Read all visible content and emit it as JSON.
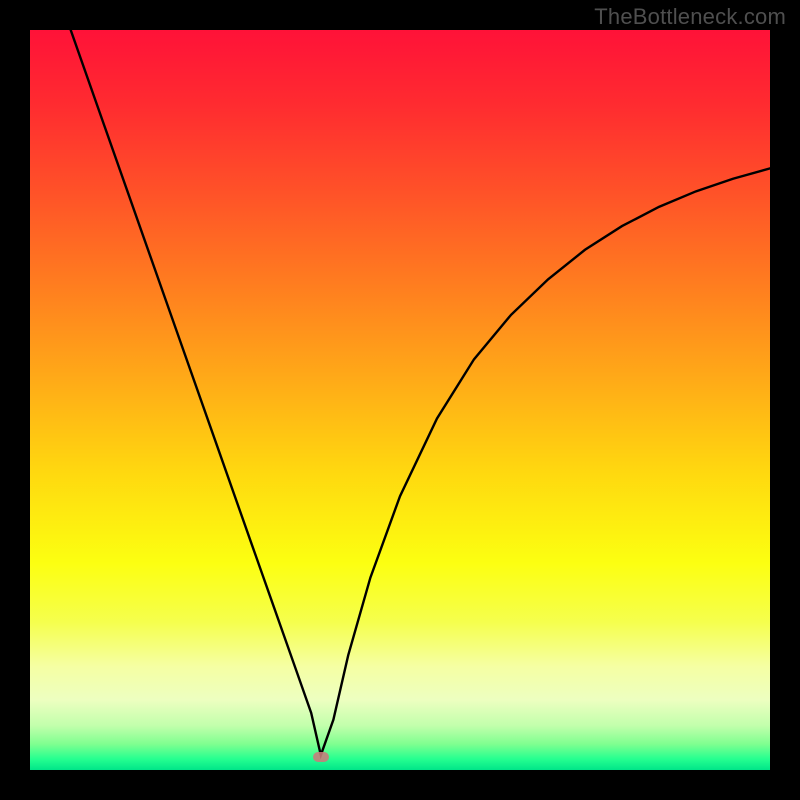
{
  "attribution": "TheBottleneck.com",
  "gradient": {
    "stops": [
      {
        "pos": 0.0,
        "color": "#ff1238"
      },
      {
        "pos": 0.1,
        "color": "#ff2b30"
      },
      {
        "pos": 0.22,
        "color": "#ff5228"
      },
      {
        "pos": 0.35,
        "color": "#ff7f1f"
      },
      {
        "pos": 0.48,
        "color": "#ffad17"
      },
      {
        "pos": 0.6,
        "color": "#ffd90f"
      },
      {
        "pos": 0.72,
        "color": "#fcff11"
      },
      {
        "pos": 0.8,
        "color": "#f5ff4d"
      },
      {
        "pos": 0.86,
        "color": "#f5ffa3"
      },
      {
        "pos": 0.905,
        "color": "#edffc0"
      },
      {
        "pos": 0.94,
        "color": "#c2ffac"
      },
      {
        "pos": 0.965,
        "color": "#7fff90"
      },
      {
        "pos": 0.985,
        "color": "#26ff90"
      },
      {
        "pos": 1.0,
        "color": "#00e589"
      }
    ]
  },
  "marker": {
    "x_frac": 0.393,
    "y_frac": 0.982,
    "color": "#c97b7b"
  },
  "chart_data": {
    "type": "line",
    "title": "",
    "xlabel": "",
    "ylabel": "",
    "xlim": [
      0,
      100
    ],
    "ylim": [
      0,
      100
    ],
    "note": "Values are estimated from pixel positions; axes are unlabeled in the source image. Y represents vertical position (0 = bottom, 100 = top). The curve is an asymmetric V / check-mark shape with minimum near x≈39.",
    "series": [
      {
        "name": "bottleneck-curve",
        "x": [
          5.5,
          10,
          15,
          20,
          25,
          30,
          33,
          36,
          38,
          39.3,
          41,
          43,
          46,
          50,
          55,
          60,
          65,
          70,
          75,
          80,
          85,
          90,
          95,
          100
        ],
        "y": [
          100,
          87.2,
          73.0,
          58.8,
          44.6,
          30.4,
          21.9,
          13.4,
          7.7,
          2.0,
          6.8,
          15.5,
          26.0,
          37.0,
          47.5,
          55.5,
          61.5,
          66.3,
          70.3,
          73.5,
          76.1,
          78.2,
          79.9,
          81.3
        ]
      }
    ],
    "marker_point": {
      "x": 39.3,
      "y": 1.8
    },
    "background_metric": "Vertical rainbow gradient (red top → green bottom) indicates bottleneck severity; green band near bottom marks optimal region."
  }
}
